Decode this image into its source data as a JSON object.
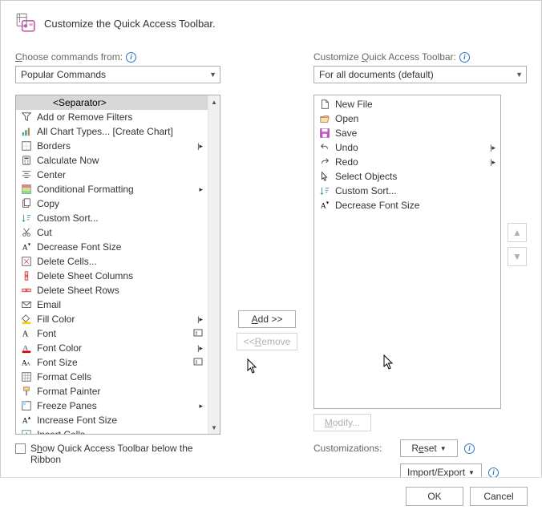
{
  "header": {
    "title": "Customize the Quick Access Toolbar."
  },
  "left": {
    "label_html": "<span class='und'>C</span>hoose commands from:",
    "dropdown": "Popular Commands",
    "items": [
      {
        "label": "<Separator>",
        "selected": true,
        "icon": "blank",
        "sep": true
      },
      {
        "label": "Add or Remove Filters",
        "icon": "funnel"
      },
      {
        "label": "All Chart Types... [Create Chart]",
        "icon": "chart"
      },
      {
        "label": "Borders",
        "icon": "borders",
        "submenu": "split"
      },
      {
        "label": "Calculate Now",
        "icon": "calc"
      },
      {
        "label": "Center",
        "icon": "center"
      },
      {
        "label": "Conditional Formatting",
        "icon": "condform",
        "submenu": "menu"
      },
      {
        "label": "Copy",
        "icon": "copy"
      },
      {
        "label": "Custom Sort...",
        "icon": "sort"
      },
      {
        "label": "Cut",
        "icon": "cut"
      },
      {
        "label": "Decrease Font Size",
        "icon": "fontdec"
      },
      {
        "label": "Delete Cells...",
        "icon": "delcells"
      },
      {
        "label": "Delete Sheet Columns",
        "icon": "delcols"
      },
      {
        "label": "Delete Sheet Rows",
        "icon": "delrows"
      },
      {
        "label": "Email",
        "icon": "email"
      },
      {
        "label": "Fill Color",
        "icon": "fillcolor",
        "submenu": "split"
      },
      {
        "label": "Font",
        "icon": "font",
        "submenu": "box"
      },
      {
        "label": "Font Color",
        "icon": "fontcolor",
        "submenu": "split"
      },
      {
        "label": "Font Size",
        "icon": "fontsize",
        "submenu": "box"
      },
      {
        "label": "Format Cells",
        "icon": "formatcells"
      },
      {
        "label": "Format Painter",
        "icon": "painter"
      },
      {
        "label": "Freeze Panes",
        "icon": "freeze",
        "submenu": "menu"
      },
      {
        "label": "Increase Font Size",
        "icon": "fontinc"
      },
      {
        "label": "Insert Cells...",
        "icon": "inscells"
      }
    ]
  },
  "right": {
    "label_html": "Customize <span class='und'>Q</span>uick Access Toolbar:",
    "dropdown": "For all documents (default)",
    "items": [
      {
        "label": "New File",
        "icon": "newfile"
      },
      {
        "label": "Open",
        "icon": "open"
      },
      {
        "label": "Save",
        "icon": "save"
      },
      {
        "label": "Undo",
        "icon": "undo",
        "submenu": "split"
      },
      {
        "label": "Redo",
        "icon": "redo",
        "submenu": "split"
      },
      {
        "label": "Select Objects",
        "icon": "pointer"
      },
      {
        "label": "Custom Sort...",
        "icon": "sort"
      },
      {
        "label": "Decrease Font Size",
        "icon": "fontdec"
      }
    ]
  },
  "buttons": {
    "add_html": "<span class='und'>A</span>dd &gt;&gt;",
    "remove_html": "&lt;&lt; <span class='und'>R</span>emove",
    "modify_html": "<span class='und'>M</span>odify...",
    "reset_html": "R<span class='und'>e</span>set",
    "import_html": "Import/Export",
    "ok": "OK",
    "cancel": "Cancel"
  },
  "labels": {
    "customizations": "Customizations:",
    "show_below_html": "S<span class='und'>h</span>ow Quick Access Toolbar below the Ribbon"
  }
}
